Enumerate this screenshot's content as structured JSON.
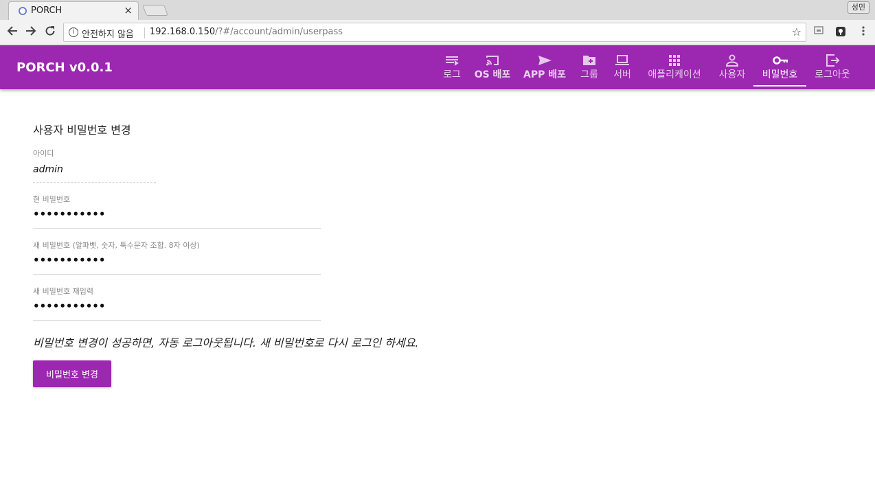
{
  "browser": {
    "tab_title": "PORCH",
    "tab_close": "×",
    "profile_name": "성민",
    "security_label": "안전하지 않음",
    "url_host": "192.168.0.150",
    "url_path": "/?#/account/admin/userpass",
    "star": "☆"
  },
  "appbar": {
    "brand": "PORCH v0.0.1",
    "nav": [
      {
        "label": "로그",
        "icon": "list-icon"
      },
      {
        "label": "OS 배포",
        "icon": "cast-icon"
      },
      {
        "label": "APP 배포",
        "icon": "send-icon"
      },
      {
        "label": "그룹",
        "icon": "folder-add-icon"
      },
      {
        "label": "서버",
        "icon": "laptop-icon"
      },
      {
        "label": "애플리케이션",
        "icon": "apps-grid-icon"
      },
      {
        "label": "사용자",
        "icon": "person-icon"
      },
      {
        "label": "비밀번호",
        "icon": "key-icon",
        "active": true
      },
      {
        "label": "로그아웃",
        "icon": "exit-icon"
      }
    ],
    "color": "#9c27b0"
  },
  "form": {
    "title": "사용자 비밀번호 변경",
    "id_label": "아이디",
    "id_value": "admin",
    "current_label": "현 비밀번호",
    "current_value": "•••••••••••",
    "new_label": "새 비밀번호 (알파벳, 숫자, 특수문자 조합. 8자 이상)",
    "new_value": "•••••••••••",
    "confirm_label": "새 비밀번호 재입력",
    "confirm_value": "•••••••••••",
    "notice": "비밀번호 변경이 성공하면, 자동 로그아웃됩니다. 새 비밀번호로 다시 로그인 하세요.",
    "submit_label": "비밀번호 변경"
  }
}
